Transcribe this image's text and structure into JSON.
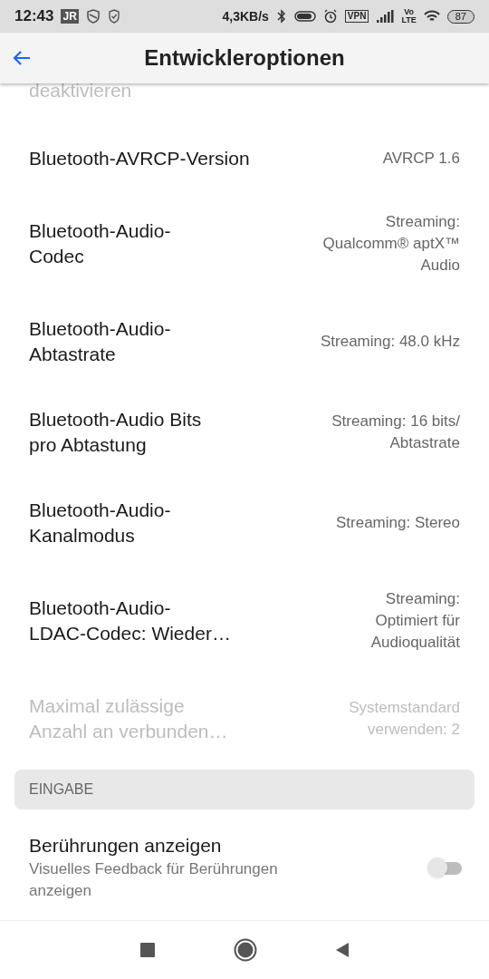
{
  "status_bar": {
    "time": "12:43",
    "badge": "JR",
    "speed": "4,3KB/s",
    "vpn": "VPN",
    "volte": [
      "Vo",
      "LTE"
    ],
    "battery": "87"
  },
  "app_bar": {
    "title": "Entwickleroptionen"
  },
  "items": [
    {
      "kind": "value",
      "title": "deaktivieren",
      "disabled": true
    },
    {
      "kind": "value",
      "title": "Bluetooth-AVRCP-Version",
      "value": "AVRCP 1.6",
      "disabled": false
    },
    {
      "kind": "value",
      "title": "Bluetooth-Audio-\nCodec",
      "value": "Streaming:\nQualcomm® aptX™\nAudio",
      "disabled": false
    },
    {
      "kind": "value",
      "title": "Bluetooth-Audio-\nAbtastrate",
      "value": "Streaming: 48.0 kHz",
      "disabled": false
    },
    {
      "kind": "value",
      "title": "Bluetooth-Audio Bits\npro Abtastung",
      "value": "Streaming: 16 bits/\nAbtastrate",
      "disabled": false
    },
    {
      "kind": "value",
      "title": "Bluetooth-Audio-\nKanalmodus",
      "value": "Streaming: Stereo",
      "disabled": false
    },
    {
      "kind": "value",
      "title": "Bluetooth-Audio-\nLDAC-Codec: Wieder…",
      "value": "Streaming:\nOptimiert für\nAudioqualität",
      "disabled": false
    },
    {
      "kind": "value",
      "title": "Maximal zulässige\nAnzahl an verbunden…",
      "value": "Systemstandard\nverwenden: 2",
      "disabled": true
    },
    {
      "kind": "section",
      "title": "EINGABE"
    },
    {
      "kind": "switch",
      "title": "Berührungen anzeigen",
      "summary": "Visuelles Feedback für Berührungen\nanzeigen",
      "on": false
    }
  ]
}
